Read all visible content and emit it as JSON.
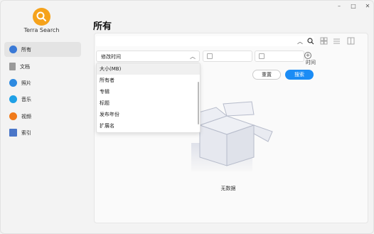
{
  "window": {
    "minimize": "–",
    "maximize": "□",
    "close": "✕"
  },
  "app": {
    "name": "Terra Search"
  },
  "sidebar": {
    "items": [
      {
        "label": "所有",
        "icon": "all-files-icon",
        "color": "#3a79d6",
        "active": true
      },
      {
        "label": "文档",
        "icon": "document-icon",
        "color": "#9a9a9a",
        "active": false
      },
      {
        "label": "照片",
        "icon": "photo-icon",
        "color": "#2d8ae0",
        "active": false
      },
      {
        "label": "音乐",
        "icon": "music-icon",
        "color": "#1fa0e6",
        "active": false
      },
      {
        "label": "视频",
        "icon": "video-icon",
        "color": "#f07a1a",
        "active": false
      },
      {
        "label": "索引",
        "icon": "index-icon",
        "color": "#4a76c8",
        "active": false
      }
    ]
  },
  "main": {
    "title": "所有",
    "search": {
      "value": "",
      "placeholder": ""
    },
    "filter": {
      "field": "修改时间",
      "time_label": "时间",
      "reset_label": "重置",
      "search_label": "搜索",
      "options": [
        "大小(MB)",
        "所有者",
        "专辑",
        "标题",
        "发布年份",
        "扩展名"
      ]
    },
    "empty": {
      "text": "无数据"
    }
  },
  "colors": {
    "accent": "#1b8cf5",
    "logo": "#f5a21b"
  }
}
